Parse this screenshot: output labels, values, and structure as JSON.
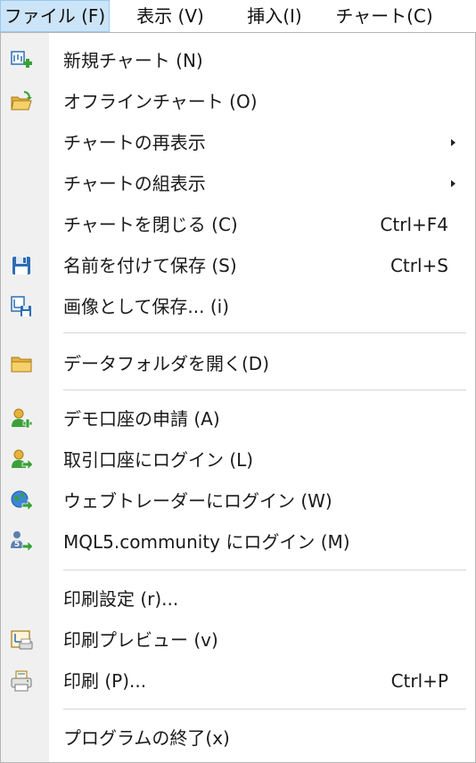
{
  "menubar": {
    "items": [
      {
        "label": "ファイル (F)"
      },
      {
        "label": "表示 (V)"
      },
      {
        "label": "挿入(I)"
      },
      {
        "label": "チャート(C)"
      }
    ]
  },
  "menu": {
    "items": [
      {
        "label": "新規チャート (N)",
        "shortcut": "",
        "icon": "new-chart-icon"
      },
      {
        "label": "オフラインチャート (O)",
        "shortcut": "",
        "icon": "open-folder-icon"
      },
      {
        "label": "チャートの再表示",
        "shortcut": "",
        "icon": ""
      },
      {
        "label": "チャートの組表示",
        "shortcut": "",
        "icon": ""
      },
      {
        "label": "チャートを閉じる (C)",
        "shortcut": "Ctrl+F4",
        "icon": ""
      },
      {
        "label": "名前を付けて保存 (S)",
        "shortcut": "Ctrl+S",
        "icon": "floppy-disk-icon"
      },
      {
        "label": "画像として保存... (i)",
        "shortcut": "",
        "icon": "save-image-icon"
      },
      {
        "label": "データフォルダを開く(D)",
        "shortcut": "",
        "icon": "folder-icon"
      },
      {
        "label": "デモ口座の申請 (A)",
        "shortcut": "",
        "icon": "user-add-icon"
      },
      {
        "label": "取引口座にログイン (L)",
        "shortcut": "",
        "icon": "user-login-icon"
      },
      {
        "label": "ウェブトレーダーにログイン (W)",
        "shortcut": "",
        "icon": "globe-login-icon"
      },
      {
        "label": "MQL5.community にログイン (M)",
        "shortcut": "",
        "icon": "mql5-login-icon"
      },
      {
        "label": "印刷設定 (r)...",
        "shortcut": "",
        "icon": ""
      },
      {
        "label": "印刷プレビュー (v)",
        "shortcut": "",
        "icon": "print-preview-icon"
      },
      {
        "label": "印刷 (P)...",
        "shortcut": "Ctrl+P",
        "icon": "printer-icon"
      },
      {
        "label": "プログラムの終了(x)",
        "shortcut": "",
        "icon": ""
      }
    ]
  },
  "colors": {
    "active_menu_bg": "#cce4f7",
    "active_menu_border": "#99c9ef",
    "gutter_bg": "#f0f0f0",
    "separator": "#d6d6d6",
    "icon_blue": "#2d6db5",
    "icon_green": "#3aa13a",
    "icon_folder": "#e8b33c"
  }
}
